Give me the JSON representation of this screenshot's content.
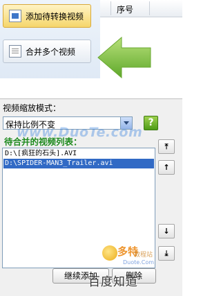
{
  "toolbar": {
    "add_button_label": "添加待转换视频",
    "merge_button_label": "合并多个视频"
  },
  "grid": {
    "column_header": "序号"
  },
  "form": {
    "mode_label": "视频缩放模式：",
    "mode_value": "保持比例不变",
    "help_label": "?"
  },
  "list": {
    "title": "待合并的视频列表：",
    "items": [
      "D:\\[疯狂的石头].AVI",
      "D:\\SPIDER-MAN3_Trailer.avi"
    ],
    "selected_index": 1
  },
  "side_buttons": {
    "top_label": "⤒",
    "up_label": "↑",
    "down_label": "↓",
    "bottom_label": "⤓"
  },
  "bottom_buttons": {
    "continue_add_label": "继续添加",
    "delete_label": "删除"
  },
  "watermarks": {
    "site": "www.DuoTe.com",
    "logo_main": "多特",
    "logo_sub": "教程站",
    "logo_url": "Duote.Com",
    "brand": "百度知道"
  },
  "colors": {
    "list_title": "#1e8a1e",
    "selection": "#316ac5",
    "arrow": "#7ac143",
    "help_button": "#4e9b17"
  },
  "icons": {
    "arrow": "green-left-arrow-icon",
    "add": "film-icon",
    "merge": "document-icon",
    "help": "help-icon"
  }
}
